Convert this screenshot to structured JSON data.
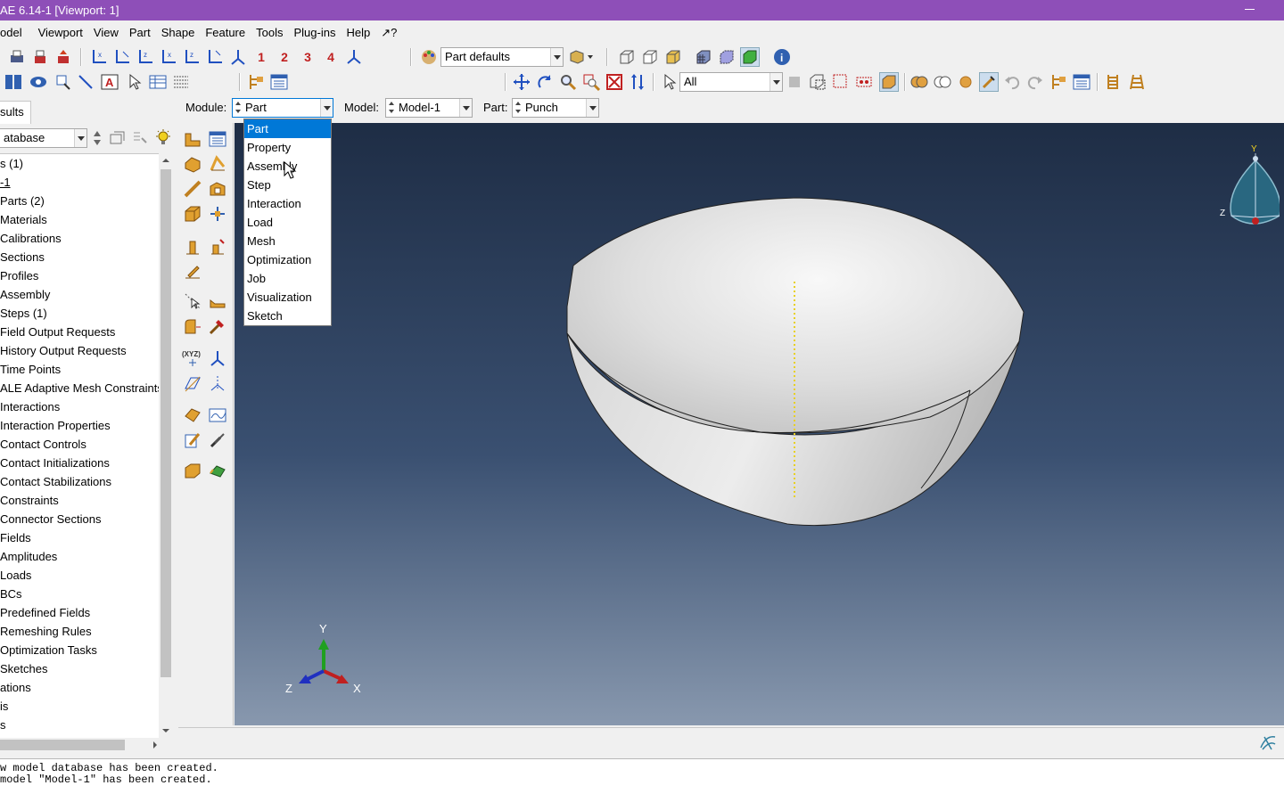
{
  "window": {
    "title": "AE 6.14-1 [Viewport: 1]"
  },
  "menu": [
    "odel",
    "Viewport",
    "View",
    "Part",
    "Shape",
    "Feature",
    "Tools",
    "Plug-ins",
    "Help",
    "↗?"
  ],
  "toolbar": {
    "views": [
      "1",
      "2",
      "3",
      "4"
    ],
    "render_style": "Part defaults",
    "selection_filter": "All"
  },
  "context": {
    "module_label": "Module:",
    "module_value": "Part",
    "model_label": "Model:",
    "model_value": "Model-1",
    "part_label": "Part:",
    "part_value": "Punch"
  },
  "module_dropdown": {
    "options": [
      "Part",
      "Property",
      "Assembly",
      "Step",
      "Interaction",
      "Load",
      "Mesh",
      "Optimization",
      "Job",
      "Visualization",
      "Sketch"
    ],
    "selected": "Part"
  },
  "left_panel": {
    "tab_label": "sults",
    "database_label": "atabase",
    "tree": [
      "s (1)",
      "-1",
      "Parts (2)",
      "Materials",
      "Calibrations",
      "Sections",
      "Profiles",
      "Assembly",
      "Steps (1)",
      "Field Output Requests",
      "History Output Requests",
      "Time Points",
      "ALE Adaptive Mesh Constraints",
      "Interactions",
      "Interaction Properties",
      "Contact Controls",
      "Contact Initializations",
      "Contact Stabilizations",
      "Constraints",
      "Connector Sections",
      "Fields",
      "Amplitudes",
      "Loads",
      "BCs",
      "Predefined Fields",
      "Remeshing Rules",
      "Optimization Tasks",
      "Sketches",
      "ations",
      "is",
      "s"
    ]
  },
  "viewport": {
    "triad_labels": {
      "x": "X",
      "y": "Y",
      "z": "Z"
    },
    "compass_labels": {
      "y": "Y",
      "z": "Z"
    }
  },
  "messages": [
    "w model database has been created.",
    "model \"Model-1\" has been created."
  ],
  "colors": {
    "titlebar": "#8e4fb8",
    "selection": "#0078d7",
    "viewport_top": "#1e2d45",
    "viewport_bottom": "#8898ae"
  }
}
